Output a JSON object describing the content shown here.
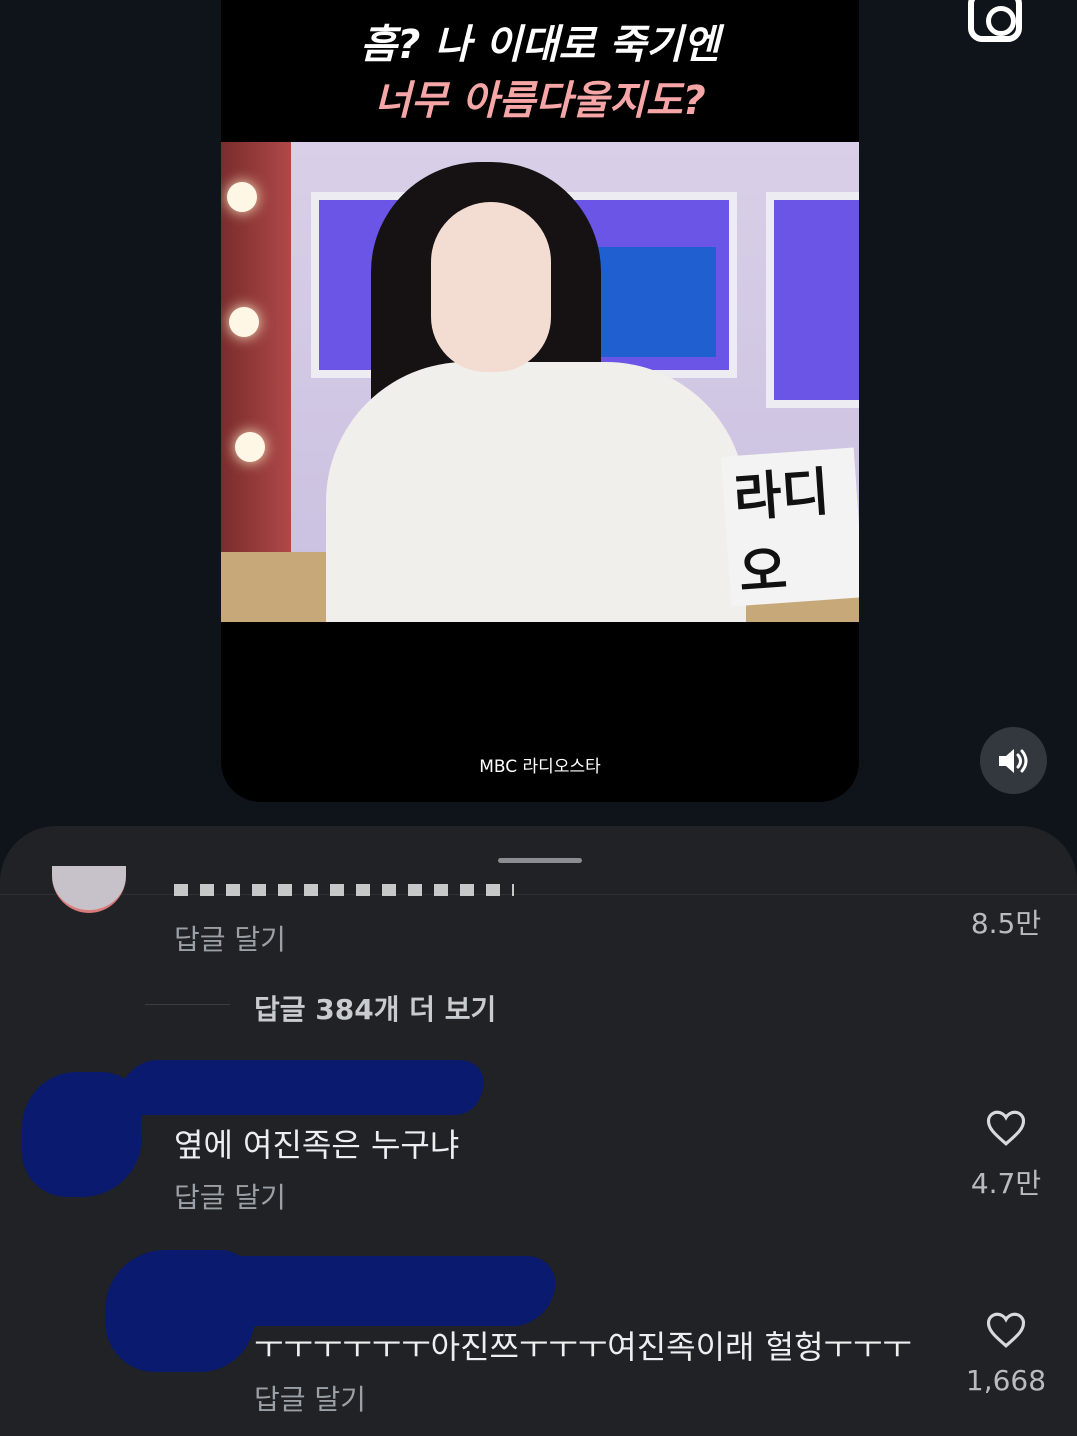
{
  "video": {
    "caption_line1": "흠? 나 이대로 죽기엔",
    "caption_line2": "너무 아름다울지도?",
    "watermark": "MBC 라디오스타",
    "sign_text": "라디오",
    "caption_color_line2": "#f6a6a6"
  },
  "icons": {
    "top_right": "camera-icon",
    "volume": "volume-icon"
  },
  "comments": {
    "first": {
      "reply_label": "답글 달기",
      "likes": "8.5만"
    },
    "more_replies": "답글 384개 더 보기",
    "second": {
      "text": "옆에 여진족은 누구냐",
      "reply_label": "답글 달기",
      "likes": "4.7만"
    },
    "third": {
      "text": "ㅜㅜㅜㅜㅜㅜ아진쯔ㅜㅜㅜ여진족이래 헐헝ㅜㅜㅜ",
      "reply_label": "답글 달기",
      "likes": "1,668"
    }
  },
  "colors": {
    "background": "#0f141a",
    "sheet": "#202225",
    "redaction": "#0a1a6e"
  }
}
